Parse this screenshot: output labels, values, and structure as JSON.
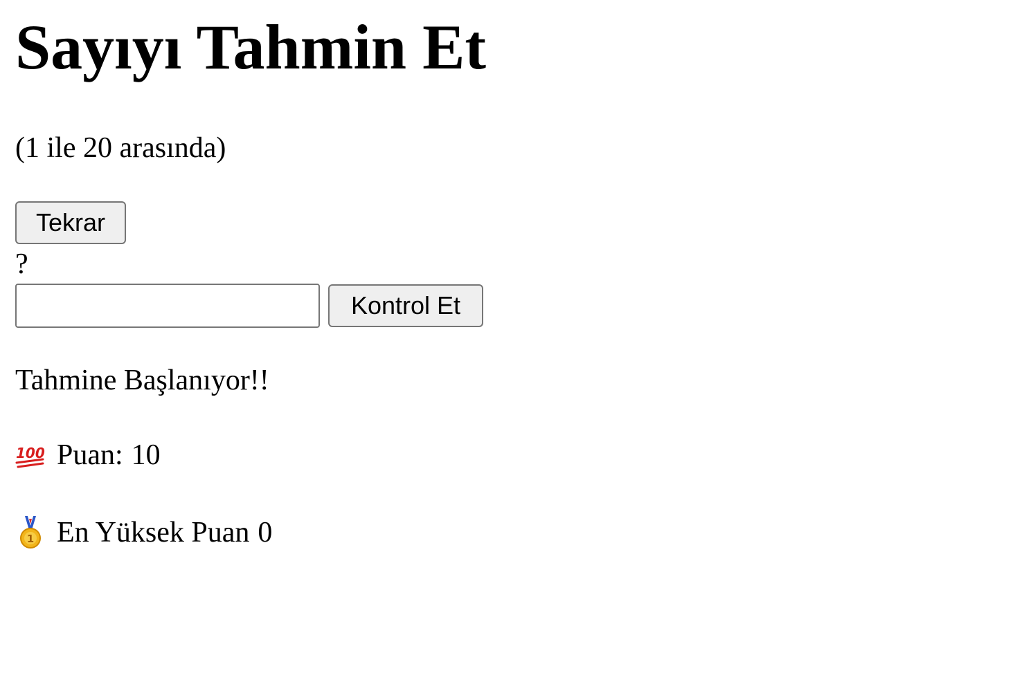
{
  "title": "Sayıyı Tahmin Et",
  "range_text": "(1 ile 20 arasında)",
  "again_button": "Tekrar",
  "secret_number": "?",
  "guess_input": {
    "value": "",
    "placeholder": ""
  },
  "check_button": "Kontrol Et",
  "message": "Tahmine Başlanıyor!!",
  "score": {
    "icon": "hundred-points-icon",
    "label": "Puan:",
    "value": "10"
  },
  "highscore": {
    "icon": "first-place-medal-icon",
    "label": "En Yüksek Puan",
    "value": "0"
  },
  "colors": {
    "button_bg": "#efefef",
    "border": "#767676",
    "emoji_red": "#d81e1e",
    "medal_gold": "#f2b51b"
  }
}
